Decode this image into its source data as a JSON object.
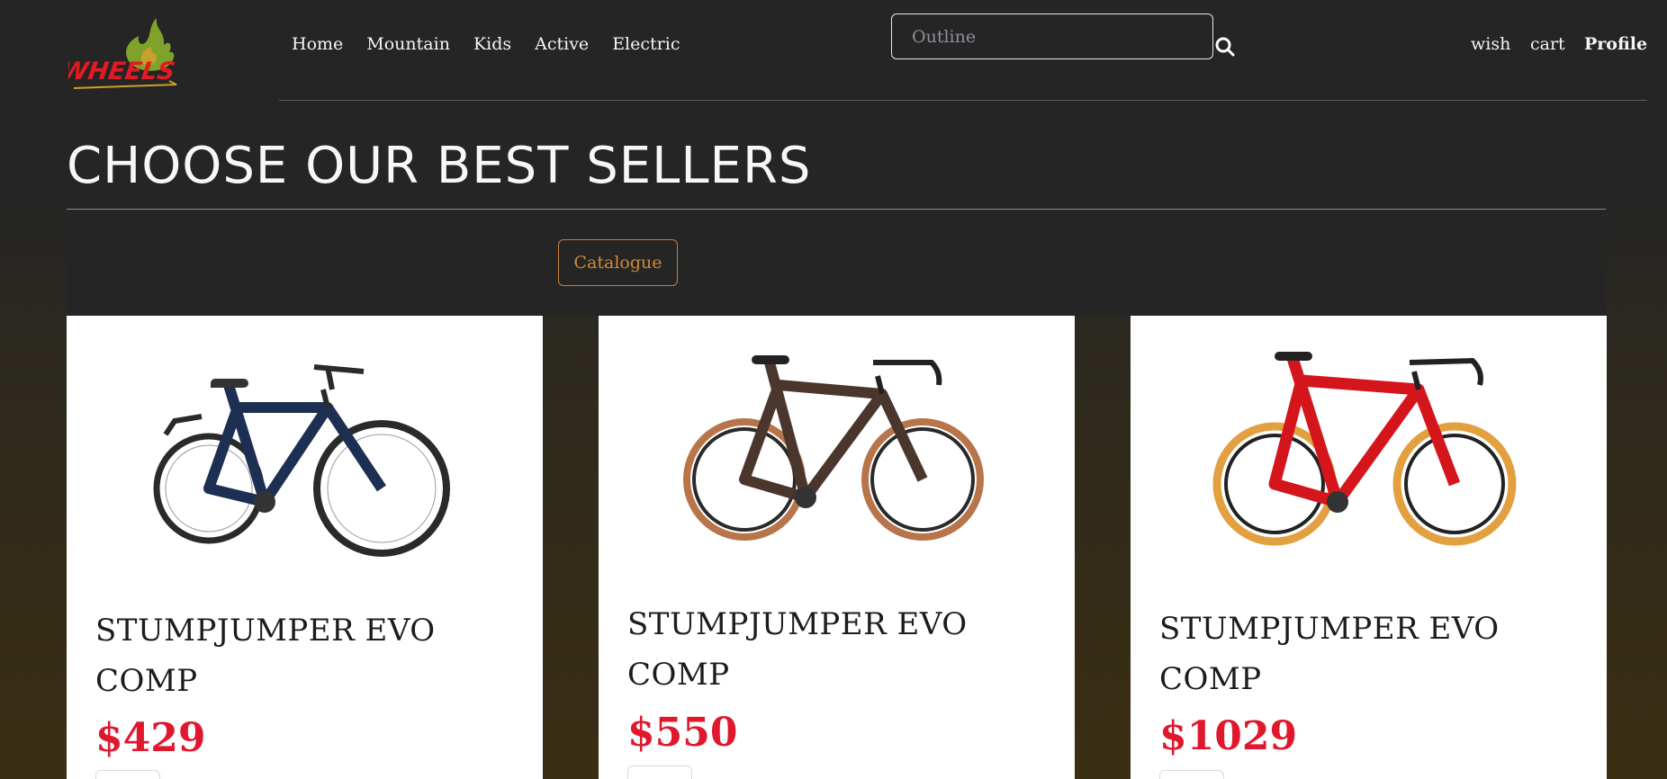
{
  "brand": {
    "logo_text": "WHEELS"
  },
  "nav": {
    "items": [
      {
        "label": "Home"
      },
      {
        "label": "Mountain"
      },
      {
        "label": "Kids"
      },
      {
        "label": "Active"
      },
      {
        "label": "Electric"
      }
    ]
  },
  "search": {
    "placeholder": "Outline",
    "icon": "search-icon"
  },
  "account_nav": {
    "wish_label": "wish",
    "cart_label": "cart",
    "profile_label": "Profile"
  },
  "main": {
    "title": "CHOOSE OUR BEST SELLERS",
    "catalogue_button": "Catalogue"
  },
  "products": [
    {
      "name": "STUMPJUMPER EVO COMP",
      "price": "$429",
      "frame_color": "#1d2f52",
      "rim_color": "#2a2a2a"
    },
    {
      "name": "STUMPJUMPER EVO COMP",
      "price": "$550",
      "frame_color": "#4a362c",
      "rim_color": "#b8744a"
    },
    {
      "name": "STUMPJUMPER EVO COMP",
      "price": "$1029",
      "frame_color": "#d5151c",
      "rim_color": "#e2a040"
    }
  ],
  "colors": {
    "background": "#252525",
    "accent_orange": "#d18a36",
    "price_red": "#e0182d",
    "logo_red": "#e21b23",
    "logo_green": "#7fa32a"
  }
}
